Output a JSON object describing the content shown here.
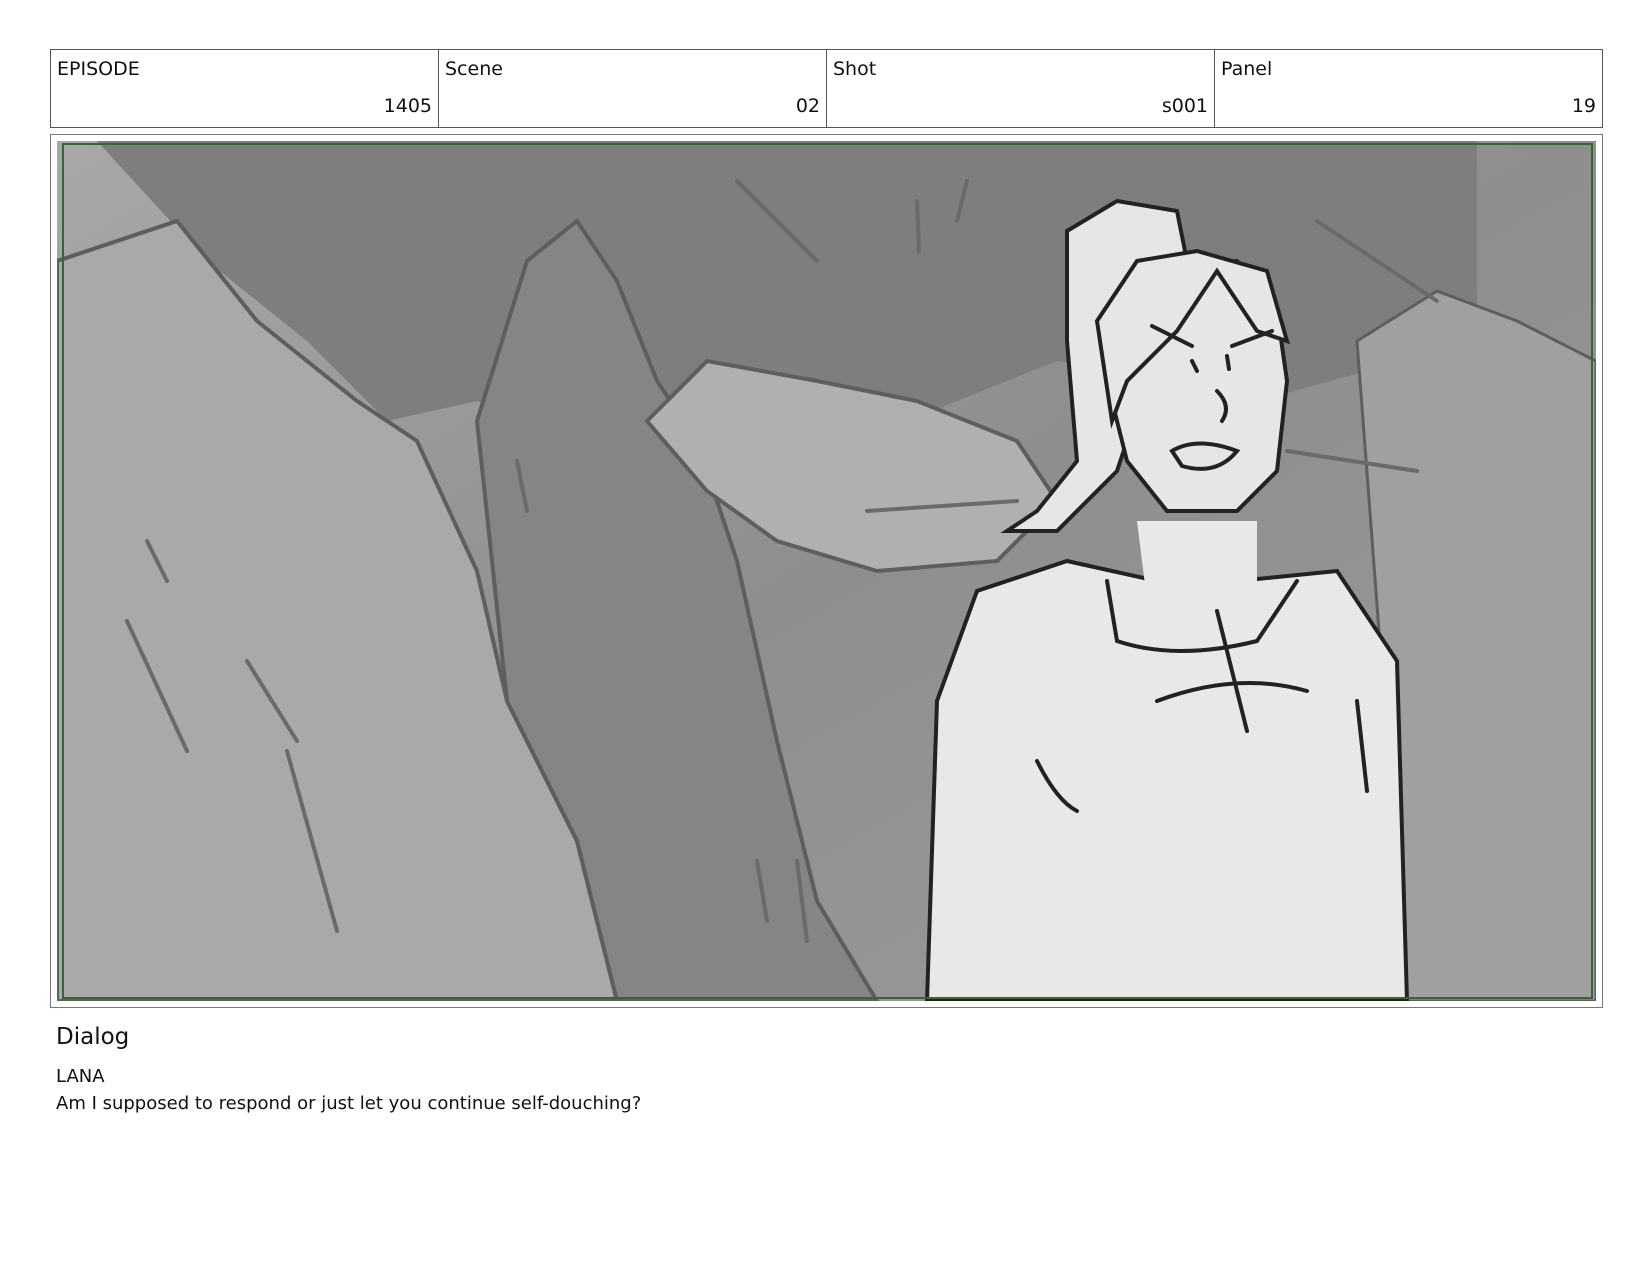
{
  "header": {
    "episode": {
      "label": "EPISODE",
      "value": "1405"
    },
    "scene": {
      "label": "Scene",
      "value": "02"
    },
    "shot": {
      "label": "Shot",
      "value": "s001"
    },
    "panel": {
      "label": "Panel",
      "value": "19"
    }
  },
  "frame": {
    "safe_area_color": "#2e6b2e",
    "image_description_icon": "storyboard-sketch"
  },
  "dialog": {
    "heading": "Dialog",
    "character": "LANA",
    "line": "Am I supposed to respond or just let you continue self-douching?"
  }
}
